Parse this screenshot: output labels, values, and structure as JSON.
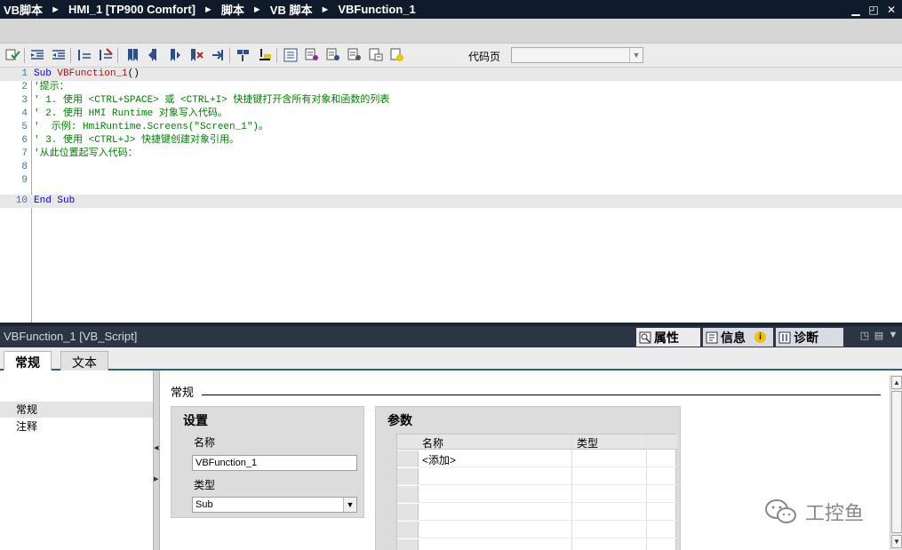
{
  "breadcrumb": [
    "VB脚本",
    "HMI_1 [TP900 Comfort]",
    "脚本",
    "VB 脚本",
    "VBFunction_1"
  ],
  "breadcrumb_separator": "►",
  "window_controls": [
    "▁",
    "◰",
    "✕"
  ],
  "toolbar": {
    "codepage_label": "代码页",
    "codepage_value": ""
  },
  "editor": {
    "lines": [
      {
        "num": "1",
        "segments": [
          {
            "t": "kw",
            "v": "Sub "
          },
          {
            "t": "fn",
            "v": "VBFunction_1"
          },
          {
            "t": "tx",
            "v": "()"
          }
        ]
      },
      {
        "num": "2",
        "segments": [
          {
            "t": "cm",
            "v": "'提示："
          }
        ]
      },
      {
        "num": "3",
        "segments": [
          {
            "t": "cm",
            "v": "' 1. 使用 <CTRL+SPACE> 或 <CTRL+I> 快捷键打开含所有对象和函数的列表"
          }
        ]
      },
      {
        "num": "4",
        "segments": [
          {
            "t": "cm",
            "v": "' 2. 使用 HMI Runtime 对象写入代码。"
          }
        ]
      },
      {
        "num": "5",
        "segments": [
          {
            "t": "cm",
            "v": "'  示例: HmiRuntime.Screens(\"Screen_1\")。"
          }
        ]
      },
      {
        "num": "6",
        "segments": [
          {
            "t": "cm",
            "v": "' 3. 使用 <CTRL+J> 快捷键创建对象引用。"
          }
        ]
      },
      {
        "num": "7",
        "segments": [
          {
            "t": "cm",
            "v": "'从此位置起写入代码："
          }
        ]
      },
      {
        "num": "8",
        "segments": []
      },
      {
        "num": "9",
        "segments": []
      },
      {
        "num": "10",
        "segments": [
          {
            "t": "kw",
            "v": "End Sub"
          }
        ]
      }
    ]
  },
  "properties": {
    "title": "VBFunction_1 [VB_Script]",
    "tabs": [
      "属性",
      "信息",
      "诊断"
    ],
    "info_badge": "i",
    "subtabs": [
      "常规",
      "文本"
    ],
    "nav_items": [
      "常规",
      "注释"
    ],
    "section_header": "常规",
    "settings": {
      "title": "设置",
      "name_label": "名称",
      "name_value": "VBFunction_1",
      "type_label": "类型",
      "type_value": "Sub"
    },
    "params": {
      "title": "参数",
      "col_name": "名称",
      "col_type": "类型",
      "add_row": "<添加>"
    }
  },
  "watermark": "工控鱼"
}
